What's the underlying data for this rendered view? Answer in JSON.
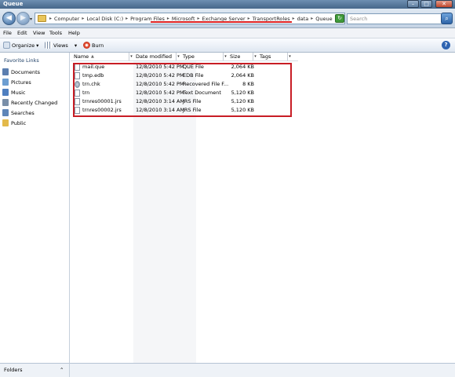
{
  "window": {
    "title": "Queue",
    "min_label": "–",
    "max_label": "□",
    "close_label": "✕"
  },
  "address": {
    "crumbs": [
      "Computer",
      "Local Disk (C:)",
      "Program Files",
      "Microsoft",
      "Exchange Server",
      "TransportRoles",
      "data",
      "Queue"
    ],
    "separator": "▸",
    "search_placeholder": "Search",
    "search_glyph": "⌕"
  },
  "menu": {
    "items": [
      "File",
      "Edit",
      "View",
      "Tools",
      "Help"
    ]
  },
  "toolbar": {
    "organize": "Organize",
    "views": "Views",
    "burn": "Burn",
    "help_glyph": "?"
  },
  "sidebar": {
    "title": "Favorite Links",
    "items": [
      {
        "label": "Documents",
        "icon": "documents-icon",
        "color": "#5c7fb0"
      },
      {
        "label": "Pictures",
        "icon": "pictures-icon",
        "color": "#6d9ed1"
      },
      {
        "label": "Music",
        "icon": "music-icon",
        "color": "#4f7fc0"
      },
      {
        "label": "Recently Changed",
        "icon": "recent-icon",
        "color": "#7a8fa8"
      },
      {
        "label": "Searches",
        "icon": "searches-icon",
        "color": "#5f86b8"
      },
      {
        "label": "Public",
        "icon": "public-folder-icon",
        "color": "#e3b94a"
      }
    ],
    "folders_label": "Folders",
    "folders_glyph": "⌃"
  },
  "columns": {
    "name": "Name",
    "date": "Date modified",
    "type": "Type",
    "size": "Size",
    "tags": "Tags",
    "dropdown_glyph": "▾",
    "sort_glyph": "▲"
  },
  "files": [
    {
      "name": "mail.que",
      "date": "12/8/2010 5:42 PM",
      "type": "QUE File",
      "size": "2,064 KB",
      "icon": "que-file-icon"
    },
    {
      "name": "tmp.edb",
      "date": "12/8/2010 5:42 PM",
      "type": "EDB File",
      "size": "2,064 KB",
      "icon": "edb-file-icon"
    },
    {
      "name": "trn.chk",
      "date": "12/8/2010 5:42 PM",
      "type": "Recovered File F...",
      "size": "8 KB",
      "icon": "chk-file-icon"
    },
    {
      "name": "trn",
      "date": "12/8/2010 5:42 PM",
      "type": "Text Document",
      "size": "5,120 KB",
      "icon": "text-file-icon"
    },
    {
      "name": "trnres00001.jrs",
      "date": "12/8/2010 3:14 AM",
      "type": "JRS File",
      "size": "5,120 KB",
      "icon": "jrs-file-icon"
    },
    {
      "name": "trnres00002.jrs",
      "date": "12/8/2010 3:14 AM",
      "type": "JRS File",
      "size": "5,120 KB",
      "icon": "jrs-file-icon"
    }
  ],
  "colors": {
    "highlight": "#c81d25",
    "underline": "#dd2222",
    "titlebar": "#46678a"
  }
}
